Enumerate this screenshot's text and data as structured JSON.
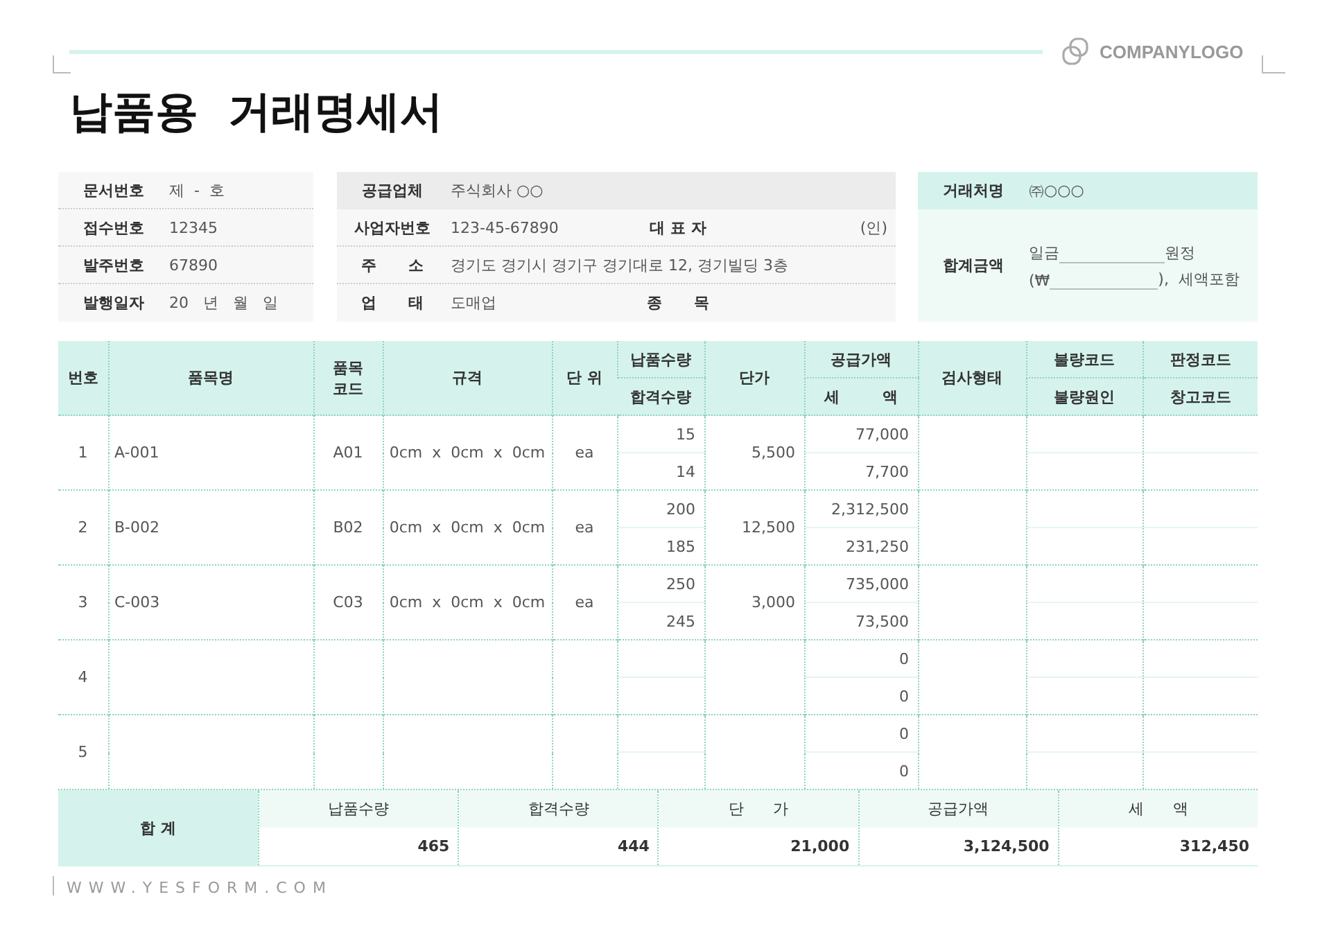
{
  "header": {
    "logo": "COMPANYLOGO",
    "title": "납품용  거래명세서"
  },
  "doc_info": [
    {
      "label": "문서번호",
      "value": "제  -  호"
    },
    {
      "label": "접수번호",
      "value": "12345"
    },
    {
      "label": "발주번호",
      "value": "67890"
    },
    {
      "label": "발행일자",
      "value": "20   년   월   일"
    }
  ],
  "supplier": [
    {
      "label": "공급업체",
      "value": "주식회사 ○○"
    },
    {
      "label": "사업자번호",
      "value": "123-45-67890",
      "extra_label": "대 표 자",
      "extra_value": "(인)"
    },
    {
      "label": "주      소",
      "value": "경기도 경기시 경기구 경기대로 12, 경기빌딩 3층"
    },
    {
      "label": "업      태",
      "value": "도매업",
      "extra_label": "종      목"
    }
  ],
  "client": {
    "name_label": "거래처명",
    "name": "㈜○○○",
    "total_label": "합계금액",
    "line1_prefix": "일금",
    "line1_suffix": "원정",
    "line2_prefix": "(₩",
    "line2_suffix": "),  세액포함"
  },
  "table": {
    "headers": [
      "번호",
      "품목명",
      "품목\n코드",
      "규격",
      "단 위",
      "납품수량",
      "단가",
      "공급가액",
      "검사형태",
      "불량코드",
      "판정코드",
      "합격수량",
      "세        액",
      "불량원인",
      "창고코드"
    ],
    "rows": [
      {
        "no": "1",
        "name": "A-001",
        "code": "A01",
        "spec": "0cm  x  0cm  x  0cm",
        "unit": "ea",
        "delivered": "15",
        "accepted": "14",
        "unit_price": "5,500",
        "supply": "77,000",
        "tax": "7,700"
      },
      {
        "no": "2",
        "name": "B-002",
        "code": "B02",
        "spec": "0cm  x  0cm  x  0cm",
        "unit": "ea",
        "delivered": "200",
        "accepted": "185",
        "unit_price": "12,500",
        "supply": "2,312,500",
        "tax": "231,250"
      },
      {
        "no": "3",
        "name": "C-003",
        "code": "C03",
        "spec": "0cm  x  0cm  x  0cm",
        "unit": "ea",
        "delivered": "250",
        "accepted": "245",
        "unit_price": "3,000",
        "supply": "735,000",
        "tax": "73,500"
      },
      {
        "no": "4",
        "supply": "0",
        "tax": "0"
      },
      {
        "no": "5",
        "supply": "0",
        "tax": "0"
      }
    ]
  },
  "totals": {
    "label": "합 계",
    "columns": [
      {
        "label": "납품수량",
        "value": "465"
      },
      {
        "label": "합격수량",
        "value": "444"
      },
      {
        "label": "단      가",
        "value": "21,000"
      },
      {
        "label": "공급가액",
        "value": "3,124,500"
      },
      {
        "label": "세      액",
        "value": "312,450"
      }
    ]
  },
  "footer": "WWW.YESFORM.COM"
}
